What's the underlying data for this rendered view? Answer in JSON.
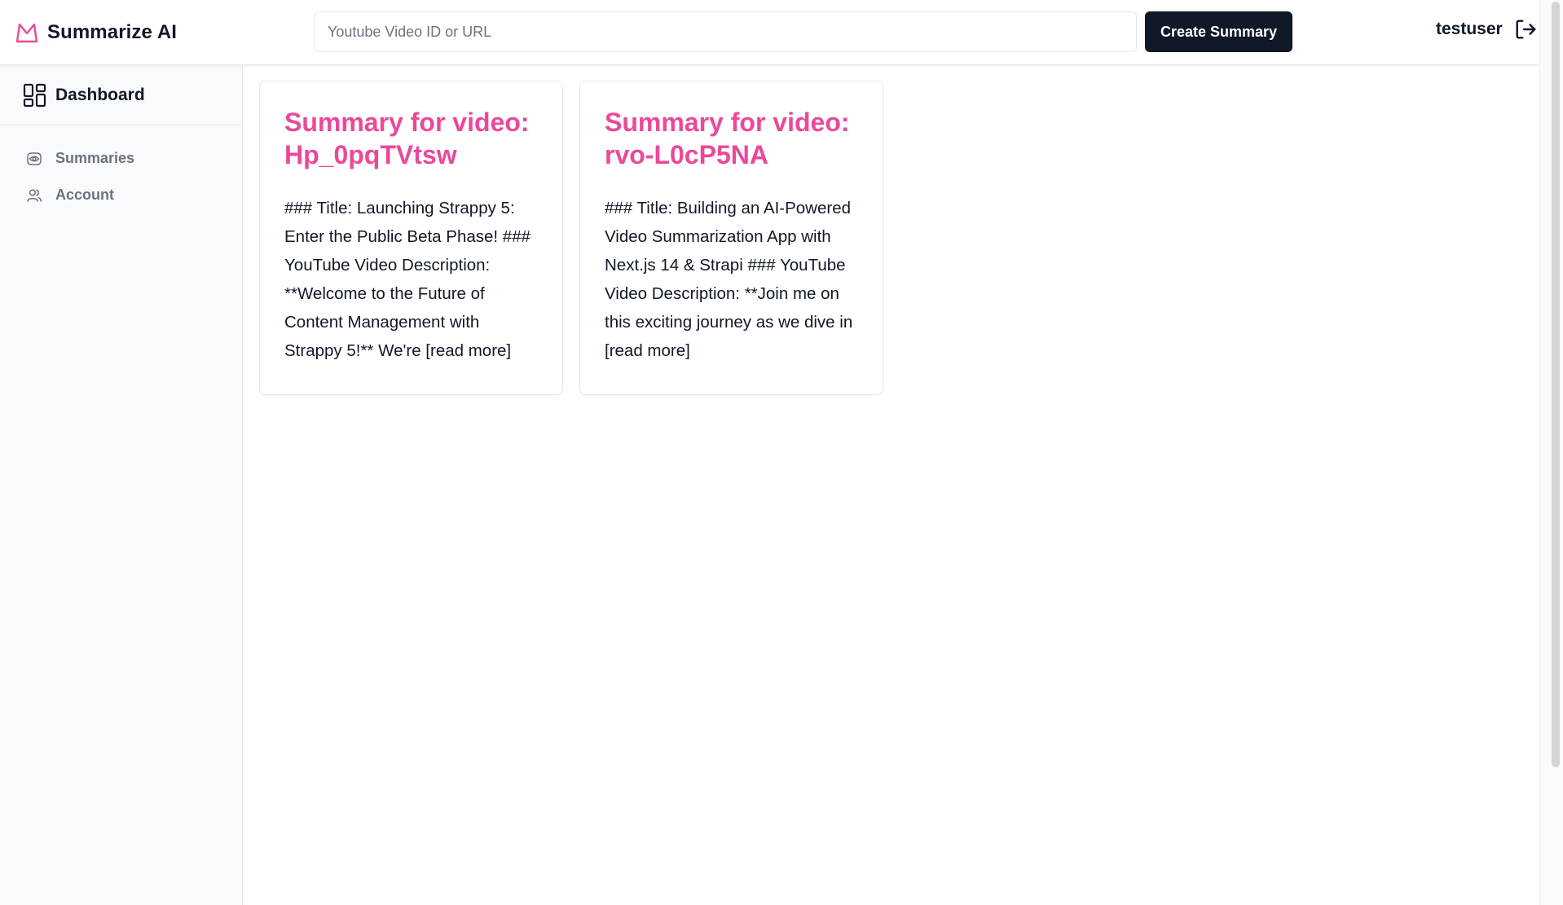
{
  "brand": {
    "name": "Summarize AI",
    "accent_color": "#ec4899",
    "logo_icon": "crown-outline-icon"
  },
  "header": {
    "search": {
      "value": "",
      "placeholder": "Youtube Video ID or URL"
    },
    "create_button_label": "Create Summary",
    "username": "testuser",
    "logout_icon": "logout-arrow-icon"
  },
  "sidebar": {
    "head": {
      "label": "Dashboard",
      "icon": "grid-layout-icon"
    },
    "items": [
      {
        "label": "Summaries",
        "icon": "eye-icon"
      },
      {
        "label": "Account",
        "icon": "users-icon"
      }
    ]
  },
  "summaries": [
    {
      "title": "Summary for video: Hp_0pqTVtsw",
      "excerpt": "### Title: Launching Strappy 5: Enter the Public Beta Phase! ### YouTube Video Description: **Welcome to the Future of Content Management with Strappy 5!** We're [read more]"
    },
    {
      "title": "Summary for video: rvo-L0cP5NA",
      "excerpt": "### Title: Building an AI-Powered Video Summarization App with Next.js 14 & Strapi ### YouTube Video Description: **Join me on this exciting journey as we dive in [read more]"
    }
  ],
  "colors": {
    "primary_dark": "#111827",
    "muted_text": "#6b7280",
    "border": "#e5e7eb"
  }
}
